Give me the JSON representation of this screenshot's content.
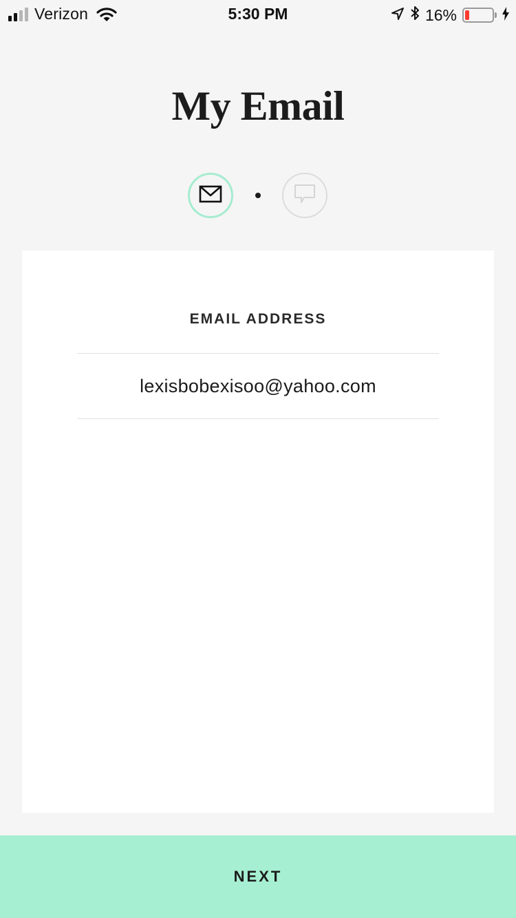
{
  "status_bar": {
    "carrier": "Verizon",
    "time": "5:30 PM",
    "battery_percent_label": "16%",
    "battery_level": 0.16,
    "signal_bars_active": 2,
    "signal_bars_total": 4,
    "icons": [
      "signal-icon",
      "wifi-icon",
      "location-arrow-icon",
      "bluetooth-icon",
      "battery-icon",
      "charging-bolt-icon"
    ],
    "battery_color": "#ff3b30"
  },
  "page": {
    "title": "My Email",
    "background": "#f5f5f5"
  },
  "steps": {
    "items": [
      {
        "icon": "envelope-icon",
        "state": "active"
      },
      {
        "icon": "chat-bubble-icon",
        "state": "inactive"
      }
    ],
    "active_color": "#a6ecd1",
    "inactive_color": "#dcdcdc"
  },
  "form": {
    "email_label": "EMAIL ADDRESS",
    "email_value": "lexisbobexisoo@yahoo.com"
  },
  "footer": {
    "next_label": "NEXT",
    "accent_color": "#a6efd2"
  }
}
